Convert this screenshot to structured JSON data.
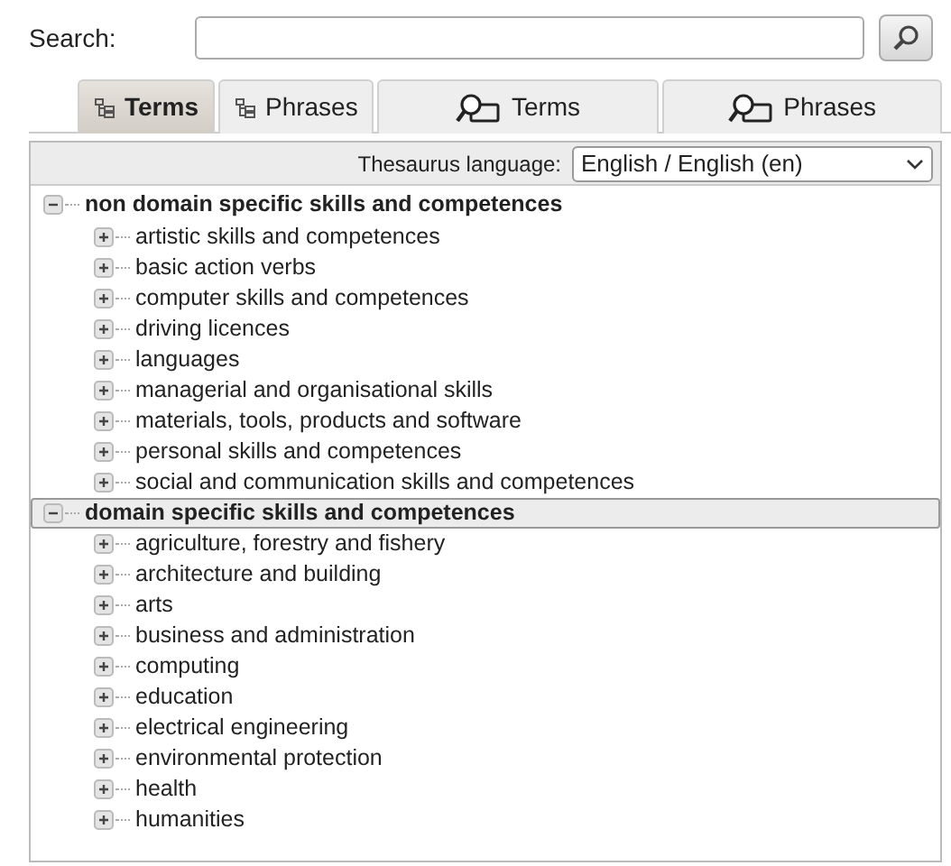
{
  "search": {
    "label": "Search:"
  },
  "tabs": [
    {
      "label": "Terms",
      "kind": "tree",
      "selected": true
    },
    {
      "label": "Phrases",
      "kind": "tree",
      "selected": false
    },
    {
      "label": "Terms",
      "kind": "search",
      "selected": false
    },
    {
      "label": "Phrases",
      "kind": "search",
      "selected": false
    }
  ],
  "language": {
    "label": "Thesaurus language:",
    "value": "English / English (en)"
  },
  "tree": [
    {
      "label": "non domain specific skills and competences",
      "expanded": true,
      "selected": false,
      "children": [
        {
          "label": "artistic skills and competences",
          "expanded": false
        },
        {
          "label": "basic action verbs",
          "expanded": false
        },
        {
          "label": "computer skills and competences",
          "expanded": false
        },
        {
          "label": "driving licences",
          "expanded": false
        },
        {
          "label": "languages",
          "expanded": false
        },
        {
          "label": "managerial and organisational skills",
          "expanded": false
        },
        {
          "label": "materials, tools, products and software",
          "expanded": false
        },
        {
          "label": "personal skills and competences",
          "expanded": false
        },
        {
          "label": "social and communication skills and competences",
          "expanded": false
        }
      ]
    },
    {
      "label": "domain specific skills and competences",
      "expanded": true,
      "selected": true,
      "children": [
        {
          "label": "agriculture, forestry and fishery",
          "expanded": false
        },
        {
          "label": "architecture and building",
          "expanded": false
        },
        {
          "label": "arts",
          "expanded": false
        },
        {
          "label": "business and administration",
          "expanded": false
        },
        {
          "label": "computing",
          "expanded": false
        },
        {
          "label": "education",
          "expanded": false
        },
        {
          "label": "electrical engineering",
          "expanded": false
        },
        {
          "label": "environmental protection",
          "expanded": false
        },
        {
          "label": "health",
          "expanded": false
        },
        {
          "label": "humanities",
          "expanded": false
        }
      ]
    }
  ]
}
